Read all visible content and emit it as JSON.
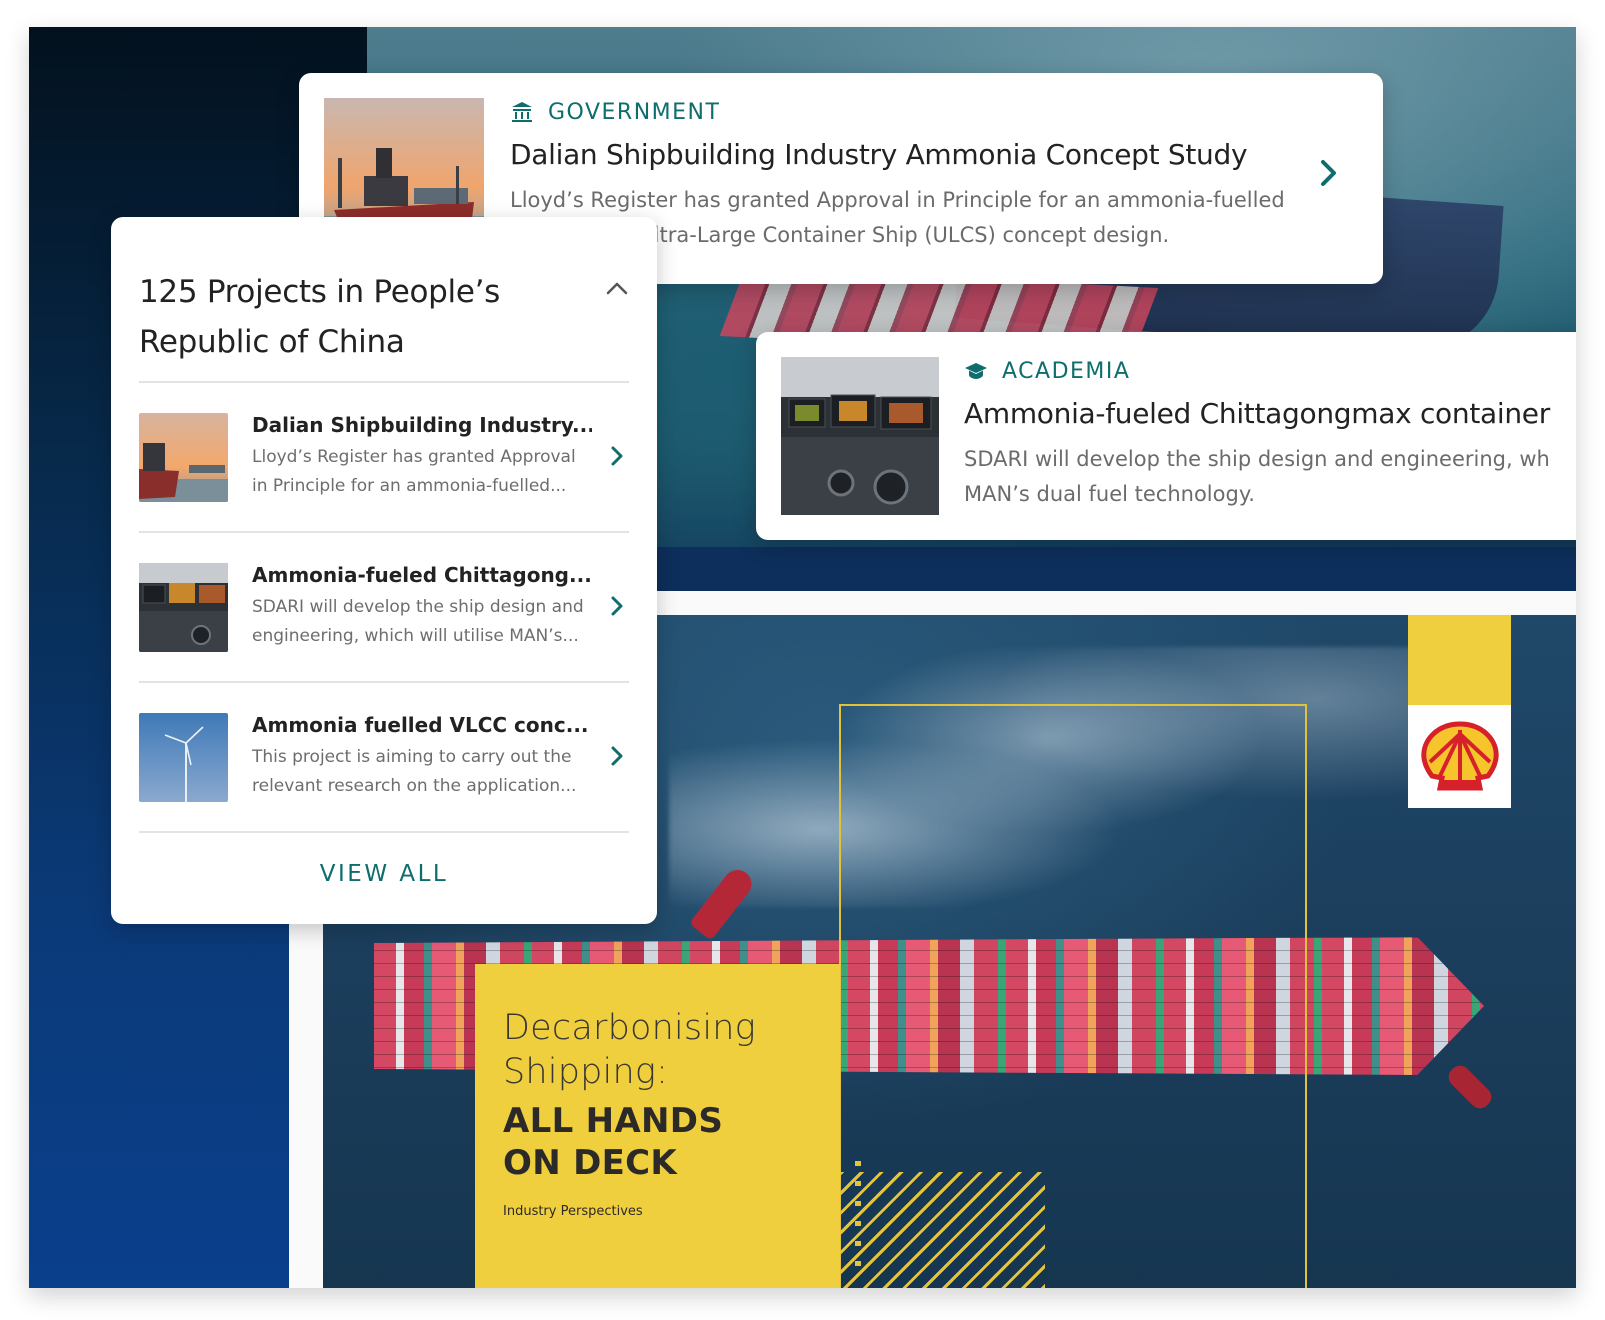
{
  "hero_card": {
    "category": "GOVERNMENT",
    "category_icon": "bank-icon",
    "title": "Dalian Shipbuilding Industry Ammonia Concept Study",
    "description": "Lloyd’s Register has granted Approval in Principle for an ammonia-fuelled 23,000 TEU Ultra-Large Container Ship (ULCS) concept design."
  },
  "secondary_card": {
    "category": "ACADEMIA",
    "category_icon": "graduation-cap-icon",
    "title": "Ammonia-fueled Chittagongmax container",
    "description_line1": "SDARI will develop the ship design and engineering, wh",
    "description_line2": "MAN’s dual fuel technology."
  },
  "project_list": {
    "heading": "125 Projects in People’s Republic of China",
    "items": [
      {
        "title": "Dalian Shipbuilding Industry...",
        "description": "Lloyd’s Register has granted Approval in Principle for an ammonia-fuelled..."
      },
      {
        "title": "Ammonia-fueled Chittagong...",
        "description": "SDARI will develop the ship design and engineering, which will utilise MAN’s..."
      },
      {
        "title": "Ammonia fuelled VLCC conc...",
        "description": "This project is aiming to carry out the relevant research on the application..."
      }
    ],
    "view_all": "VIEW ALL"
  },
  "promo": {
    "line1": "Decarbonising",
    "line2": "Shipping:",
    "bold1": "ALL HANDS",
    "bold2": "ON DECK",
    "subtitle": "Industry Perspectives",
    "brand_logo": "shell-logo"
  },
  "colors": {
    "accent": "#0e6d6d",
    "promo_yellow": "#f0cf3f",
    "navy": "#0a3f8c"
  }
}
